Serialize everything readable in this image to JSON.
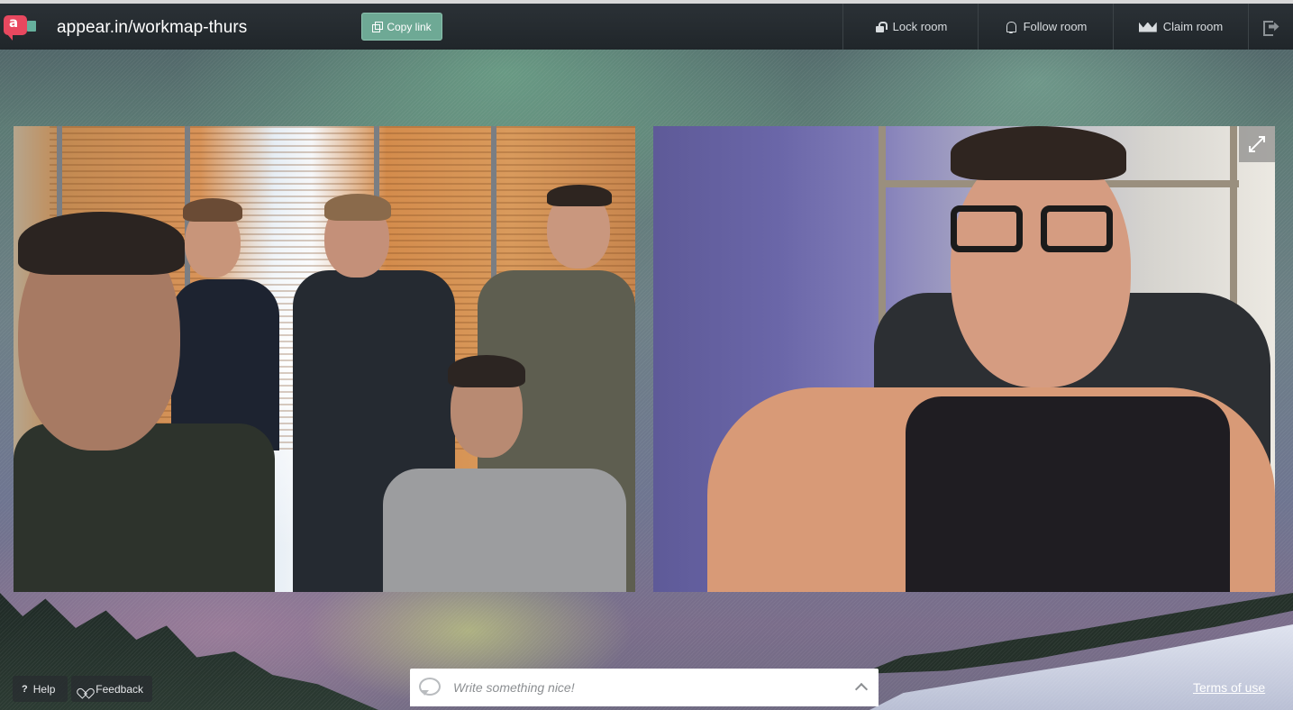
{
  "header": {
    "room_name": "appear.in/workmap-thurs",
    "copy_link_label": "Copy link",
    "actions": {
      "lock_room": "Lock room",
      "follow_room": "Follow room",
      "claim_room": "Claim room"
    },
    "icons": {
      "logo": "appear-in-logo",
      "copy": "copy-icon",
      "lock": "lock-icon",
      "follow": "bell-icon",
      "claim": "crown-icon",
      "leave": "exit-icon"
    }
  },
  "videos": {
    "tiles": [
      {
        "id": "left",
        "description_icon": "video-feed"
      },
      {
        "id": "right",
        "description_icon": "video-feed",
        "expand_icon": "expand-icon"
      }
    ]
  },
  "footer": {
    "help_label": "Help",
    "feedback_label": "Feedback",
    "chat_placeholder": "Write something nice!",
    "terms_label": "Terms of use"
  },
  "colors": {
    "brand_red": "#e8485f",
    "copy_button": "#6ea995",
    "topbar": "#22282c"
  }
}
